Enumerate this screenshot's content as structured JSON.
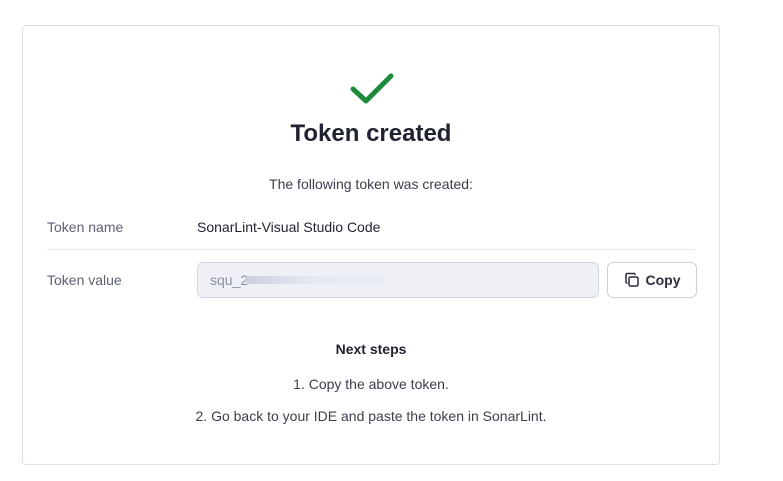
{
  "header": {
    "title": "Token created",
    "subtitle": "The following token was created:"
  },
  "token": {
    "name_label": "Token name",
    "name_value": "SonarLint-Visual Studio Code",
    "value_label": "Token value",
    "value_prefix": "squ_2",
    "copy_label": "Copy"
  },
  "next_steps": {
    "title": "Next steps",
    "items": [
      "1. Copy the above token.",
      "2. Go back to your IDE and paste the token in SonarLint."
    ]
  },
  "colors": {
    "success": "#1e8a3c"
  },
  "icons": {
    "success": "check-icon",
    "copy": "copy-icon"
  }
}
